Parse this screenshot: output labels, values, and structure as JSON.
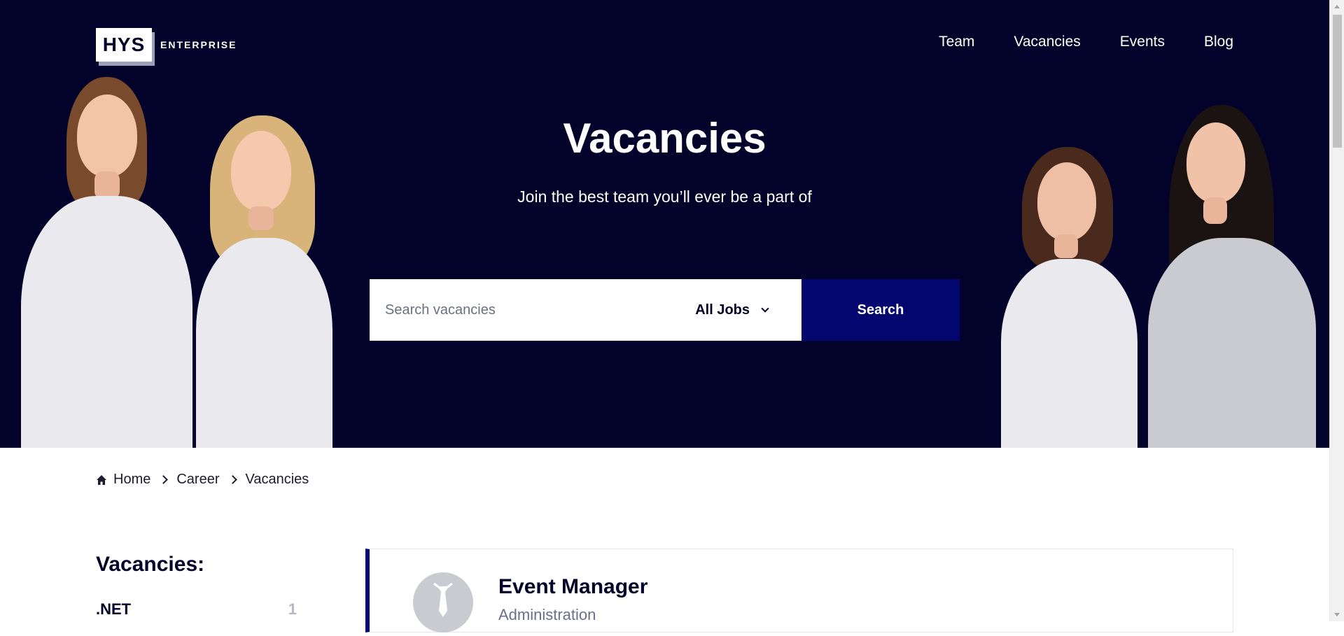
{
  "header": {
    "logo_mark": "HYS",
    "logo_text": "ENTERPRISE",
    "nav": [
      "Team",
      "Vacancies",
      "Events",
      "Blog"
    ]
  },
  "hero": {
    "title": "Vacancies",
    "subtitle": "Join the best team you’ll ever be a part of"
  },
  "search": {
    "placeholder": "Search vacancies",
    "filter_selected": "All Jobs",
    "button_label": "Search"
  },
  "breadcrumb": [
    "Home",
    "Career",
    "Vacancies"
  ],
  "sidebar": {
    "title": "Vacancies:",
    "items": [
      {
        "label": ".NET",
        "count": "1"
      }
    ]
  },
  "vacancy_card": {
    "title": "Event Manager",
    "department": "Administration"
  },
  "colors": {
    "hero_bg": "#02022a",
    "accent": "#03066e",
    "text_dark": "#02022a"
  },
  "icons": [
    "home-icon",
    "chevron-right-icon",
    "chevron-down-icon",
    "tie-icon"
  ]
}
